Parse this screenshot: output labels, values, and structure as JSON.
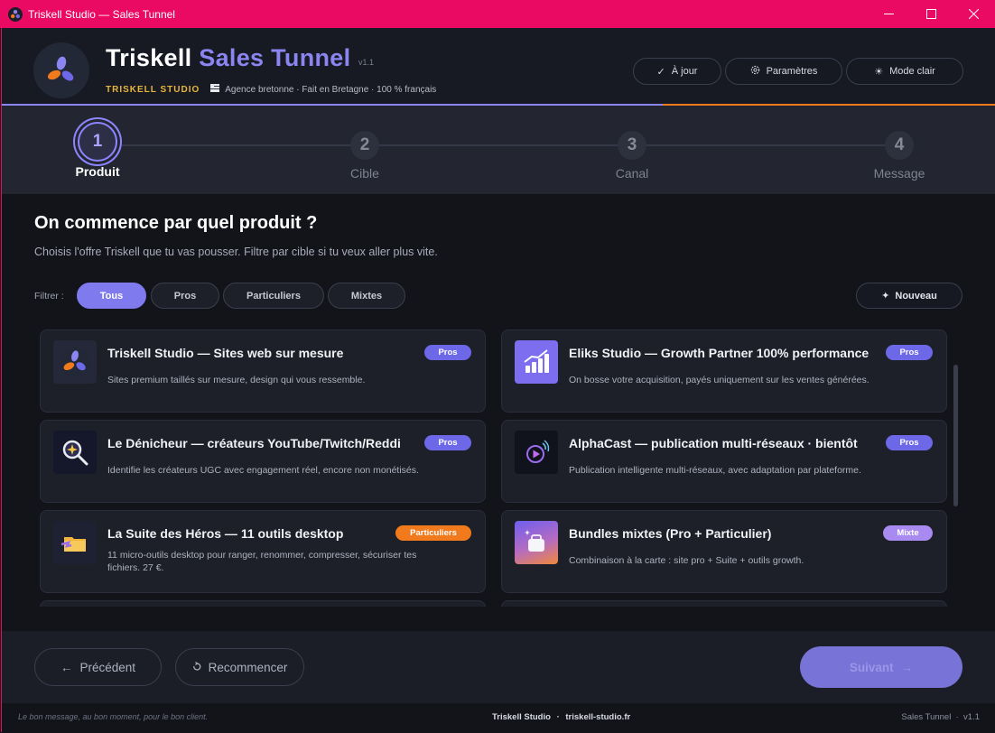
{
  "window": {
    "title": "Triskell Studio — Sales Tunnel",
    "controls": [
      "minimize-icon",
      "maximize-icon",
      "close-icon"
    ]
  },
  "header": {
    "title_main": "Triskell",
    "title_accent": "Sales Tunnel",
    "version": "v1.1",
    "studio_tag": "TRISKELL  STUDIO",
    "tagline": "Agence bretonne · Fait en Bretagne · 100 % français",
    "buttons": {
      "up_to_date": "À jour",
      "settings": "Paramètres",
      "light_mode": "Mode clair"
    }
  },
  "stepper": {
    "current_step": 1,
    "steps": [
      {
        "number": "1",
        "label": "Produit"
      },
      {
        "number": "2",
        "label": "Cible"
      },
      {
        "number": "3",
        "label": "Canal"
      },
      {
        "number": "4",
        "label": "Message"
      }
    ]
  },
  "main": {
    "title": "On commence par quel produit ?",
    "description": "Choisis l'offre Triskell que tu vas pousser. Filtre par cible si tu veux aller plus vite.",
    "filter_label": "Filtrer :",
    "filters": [
      "Tous",
      "Pros",
      "Particuliers",
      "Mixtes"
    ],
    "active_filter": "Tous",
    "new_button": "Nouveau"
  },
  "products": [
    {
      "title": "Triskell Studio — Sites web sur mesure",
      "description": "Sites premium taillés sur mesure, design qui vous ressemble.",
      "badge": "Pros",
      "icon": "triskell-logo-icon"
    },
    {
      "title": "Eliks Studio — Growth Partner 100% performance",
      "description": "On bosse votre acquisition, payés uniquement sur les ventes générées.",
      "badge": "Pros",
      "icon": "growth-chart-icon"
    },
    {
      "title": "Le Dénicheur — créateurs YouTube/Twitch/Reddi",
      "description": "Identifie les créateurs UGC avec engagement réel, encore non monétisés.",
      "badge": "Pros",
      "icon": "magnifier-icon"
    },
    {
      "title": "AlphaCast — publication multi-réseaux  ·  bientôt",
      "description": "Publication intelligente multi-réseaux, avec adaptation par plateforme.",
      "badge": "Pros",
      "icon": "broadcast-play-icon"
    },
    {
      "title": "La Suite des Héros — 11 outils desktop",
      "description": "11 micro-outils desktop pour ranger, renommer, compresser, sécuriser tes fichiers. 27 €.",
      "badge": "Particuliers",
      "icon": "hero-folder-icon"
    },
    {
      "title": "Bundles mixtes (Pro + Particulier)",
      "description": "Combinaison à la carte : site pro + Suite + outils growth.",
      "badge": "Mixte",
      "icon": "bundle-box-icon"
    }
  ],
  "colors": {
    "accent": "#8a85f0",
    "titlebar": "#ea0a63",
    "badge_pros": "#6d68e8",
    "badge_particuliers": "#f07a1c",
    "badge_mixte": "#a98af0",
    "studio_tag": "#e7b53b"
  },
  "nav": {
    "previous": "Précédent",
    "restart": "Recommencer",
    "next": "Suivant"
  },
  "status": {
    "left": "Le bon message, au bon moment, pour le bon client.",
    "center_name": "Triskell Studio",
    "center_sep": "·",
    "center_url": "triskell-studio.fr",
    "right": "Sales Tunnel  ·  v1.1"
  }
}
